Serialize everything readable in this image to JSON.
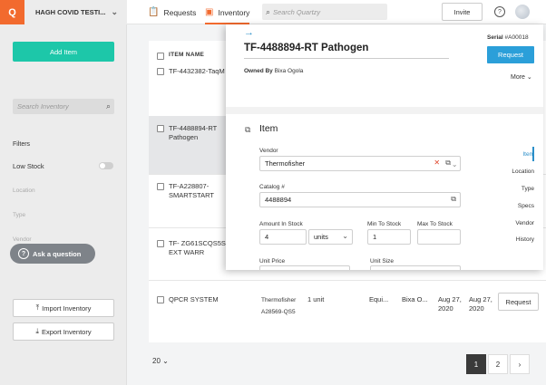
{
  "topbar": {
    "logo": "Q",
    "org_name": "HAGH COVID TESTI...",
    "tabs": [
      {
        "label": "Requests",
        "icon": "clipboard-icon"
      },
      {
        "label": "Inventory",
        "icon": "box-icon"
      }
    ],
    "search_placeholder": "Search Quartzy",
    "invite_label": "Invite",
    "help_label": "?"
  },
  "sidebar": {
    "add_item_label": "Add Item",
    "search_placeholder": "Search Inventory",
    "filters_label": "Filters",
    "low_stock_label": "Low Stock",
    "facets": [
      "Location",
      "Type",
      "Vendor"
    ],
    "ask_label": "Ask a question",
    "import_label": "Import Inventory",
    "export_label": "Export Inventory"
  },
  "table": {
    "header_item_name": "ITEM NAME",
    "rows": [
      {
        "name": "TF-4432382-TaqM"
      },
      {
        "name_line1": "TF-4488894-RT",
        "name_line2": "Pathogen"
      },
      {
        "name_line1": "TF-A228807-",
        "name_line2": "SMARTSTART"
      },
      {
        "name_line1": "TF- ZG61SCQS5S",
        "name_line2": "EXT WARR"
      },
      {
        "name": "QPCR SYSTEM",
        "vendor": "Thermofisher",
        "catalog": "A28569-QS5",
        "unit": "1 unit",
        "type": "Equi...",
        "owner": "Bixa O...",
        "date1_line1": "Aug 27,",
        "date1_line2": "2020",
        "date2_line1": "Aug 27,",
        "date2_line2": "2020",
        "request_label": "Request"
      }
    ]
  },
  "pagination": {
    "per_page": "20",
    "pages": [
      "1",
      "2"
    ],
    "next": "›"
  },
  "panel": {
    "arrow": "→",
    "title": "TF-4488894-RT Pathogen",
    "owned_by_label": "Owned By",
    "owner": "Bixa Ogola",
    "serial_label": "Serial",
    "serial": "#A00018",
    "request_label": "Request",
    "more_label": "More",
    "section_title": "Item",
    "vendor_label": "Vendor",
    "vendor_value": "Thermofisher",
    "catalog_label": "Catalog #",
    "catalog_value": "4488894",
    "amount_label": "Amount In Stock",
    "amount_value": "4",
    "amount_unit": "units",
    "min_label": "Min To Stock",
    "min_value": "1",
    "max_label": "Max To Stock",
    "max_value": "",
    "unit_price_label": "Unit Price",
    "unit_size_label": "Unit Size",
    "side_nav": [
      "Item",
      "Location",
      "Type",
      "Specs",
      "Vendor",
      "History"
    ]
  }
}
